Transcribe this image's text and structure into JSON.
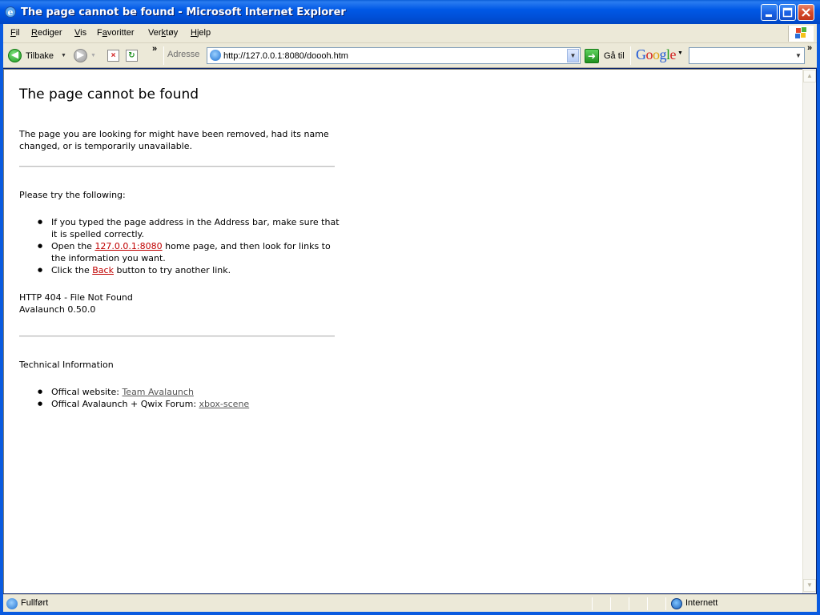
{
  "window": {
    "title": "The page cannot be found - Microsoft Internet Explorer"
  },
  "menu": {
    "items": [
      {
        "label": "Fil",
        "accel": "F"
      },
      {
        "label": "Rediger",
        "accel": "R"
      },
      {
        "label": "Vis",
        "accel": "V"
      },
      {
        "label": "Favoritter",
        "accel": "a"
      },
      {
        "label": "Verktøy",
        "accel": "k"
      },
      {
        "label": "Hjelp",
        "accel": "H"
      }
    ]
  },
  "toolbar": {
    "back_label": "Tilbake",
    "address_label": "Adresse",
    "address_value": "http://127.0.0.1:8080/doooh.htm",
    "go_label": "Gå til",
    "google_search_value": ""
  },
  "page": {
    "heading": "The page cannot be found",
    "intro": "The page you are looking for might have been removed, had its name changed, or is temporarily unavailable.",
    "try_heading": "Please try the following:",
    "tips": {
      "tip1": "If you typed the page address in the Address bar, make sure that it is spelled correctly.",
      "tip2_before": "Open the ",
      "tip2_link": "127.0.0.1:8080",
      "tip2_after": " home page, and then look for links to the information you want.",
      "tip3_before": "Click the ",
      "tip3_link": "Back",
      "tip3_after": " button to try another link."
    },
    "error_code": "HTTP 404 - File Not Found",
    "server": "Avalaunch 0.50.0",
    "tech_heading": "Technical Information",
    "tech": {
      "website_label": "Offical website: ",
      "website_link": "Team Avalaunch",
      "forum_label": "Offical Avalaunch + Qwix Forum: ",
      "forum_link": "xbox-scene"
    }
  },
  "statusbar": {
    "status": "Fullført",
    "zone": "Internett"
  },
  "colors": {
    "titlebar": "#0058e6",
    "chrome": "#ece9d8",
    "link_red": "#c00000"
  }
}
